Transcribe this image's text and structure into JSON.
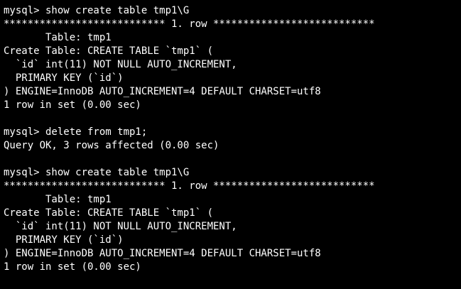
{
  "terminal": {
    "background": "#000000",
    "foreground": "#ffffff",
    "lines": [
      "mysql> show create table tmp1\\G",
      "*************************** 1. row ***************************",
      "       Table: tmp1",
      "Create Table: CREATE TABLE `tmp1` (",
      "  `id` int(11) NOT NULL AUTO_INCREMENT,",
      "  PRIMARY KEY (`id`)",
      ") ENGINE=InnoDB AUTO_INCREMENT=4 DEFAULT CHARSET=utf8",
      "1 row in set (0.00 sec)",
      "",
      "mysql> delete from tmp1;",
      "Query OK, 3 rows affected (0.00 sec)",
      "",
      "mysql> show create table tmp1\\G",
      "*************************** 1. row ***************************",
      "       Table: tmp1",
      "Create Table: CREATE TABLE `tmp1` (",
      "  `id` int(11) NOT NULL AUTO_INCREMENT,",
      "  PRIMARY KEY (`id`)",
      ") ENGINE=InnoDB AUTO_INCREMENT=4 DEFAULT CHARSET=utf8",
      "1 row in set (0.00 sec)"
    ]
  }
}
